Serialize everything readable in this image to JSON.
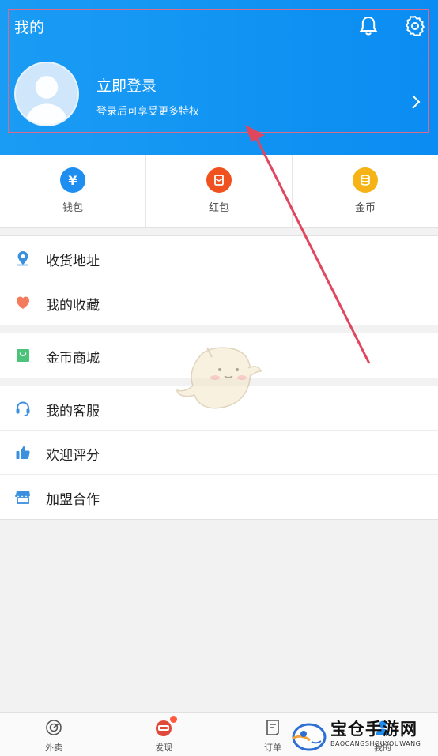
{
  "header": {
    "title": "我的",
    "login_title": "立即登录",
    "login_subtitle": "登录后可享受更多特权",
    "bg_color": "#0a8cf2"
  },
  "quick_actions": [
    {
      "label": "钱包",
      "icon": "wallet-icon",
      "color": "#1e8ff0",
      "glyph": "¥"
    },
    {
      "label": "红包",
      "icon": "red-envelope-icon",
      "color": "#f0521f",
      "glyph": ""
    },
    {
      "label": "金币",
      "icon": "gold-coin-icon",
      "color": "#f5b316",
      "glyph": ""
    }
  ],
  "menu_groups": [
    [
      {
        "label": "收货地址",
        "icon": "location-pin-icon"
      },
      {
        "label": "我的收藏",
        "icon": "heart-icon"
      }
    ],
    [
      {
        "label": "金币商城",
        "icon": "shopping-bag-icon"
      }
    ],
    [
      {
        "label": "我的客服",
        "icon": "headset-icon"
      },
      {
        "label": "欢迎评分",
        "icon": "thumbs-up-icon"
      },
      {
        "label": "加盟合作",
        "icon": "storefront-icon"
      }
    ]
  ],
  "tabbar": [
    {
      "label": "外卖",
      "icon": "takeout-icon"
    },
    {
      "label": "发现",
      "icon": "discover-icon"
    },
    {
      "label": "订单",
      "icon": "order-icon"
    },
    {
      "label": "我的",
      "icon": "profile-icon"
    }
  ],
  "watermark": {
    "title": "宝仓手游网",
    "subtitle": "BAOCANGSHOUYOUWANG"
  },
  "colors": {
    "annotation_arrow": "#e0475e",
    "accent": "#1e8ff0"
  }
}
